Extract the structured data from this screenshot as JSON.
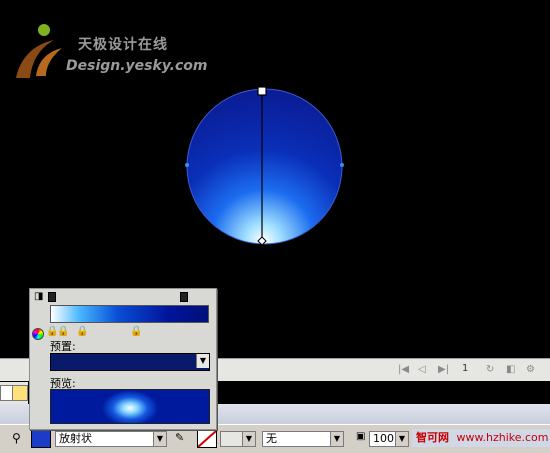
{
  "watermark": {
    "title_cn": "天极设计在线",
    "site": "Design.yesky.com"
  },
  "color_mixer": {
    "preset_label": "预置:",
    "preview_label": "预览:"
  },
  "timeline": {
    "frame": "1"
  },
  "properties": {
    "fill_type": "放射状",
    "stroke_style": "无",
    "zoom": "100"
  },
  "footer_site": {
    "brand": "智可网",
    "url": "www.hzhike.com"
  },
  "colors": {
    "canvas_bg": "#000000",
    "gradient_dark": "#00107a",
    "gradient_mid": "#0a4fd6",
    "gradient_light": "#ffffff",
    "panel_bg": "#d4d0c8"
  },
  "icons": [
    "logo-swoosh-icon",
    "transform-handle-icon",
    "play-controls-icon",
    "color-wheel-icon",
    "lock-icon",
    "pencil-icon",
    "paint-bucket-icon",
    "zoom-icon"
  ]
}
